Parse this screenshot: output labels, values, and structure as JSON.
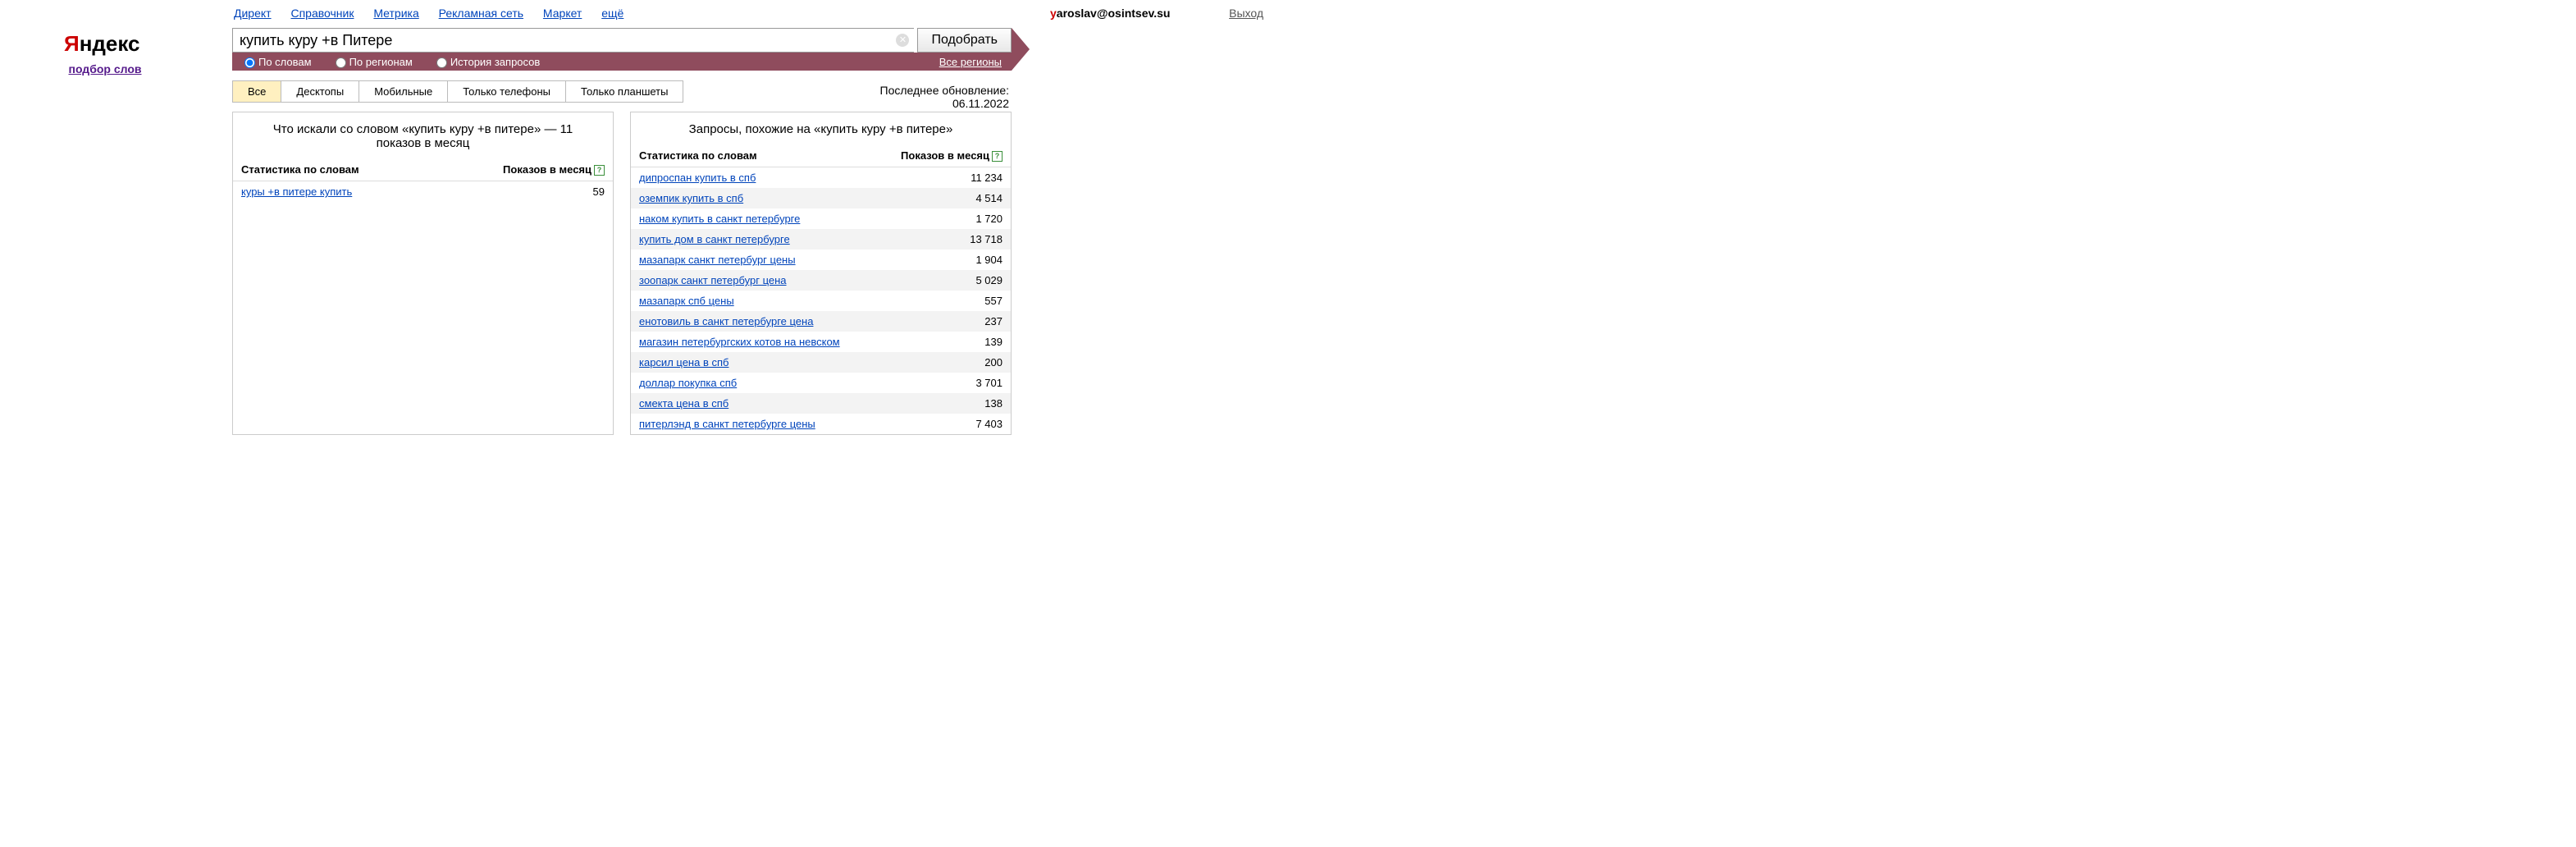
{
  "top_nav": {
    "links": [
      "Директ",
      "Справочник",
      "Метрика",
      "Рекламная сеть",
      "Маркет",
      "ещё"
    ]
  },
  "user": {
    "email_first": "y",
    "email_rest": "aroslav@osintsev.su",
    "logout": "Выход"
  },
  "logo": {
    "subtitle": "подбор слов"
  },
  "search": {
    "value": "купить куру +в Питере",
    "submit": "Подобрать",
    "mode_words": "По словам",
    "mode_regions": "По регионам",
    "mode_history": "История запросов",
    "regions_label": "Все регионы"
  },
  "device_tabs": [
    "Все",
    "Десктопы",
    "Мобильные",
    "Только телефоны",
    "Только планшеты"
  ],
  "last_update": "Последнее обновление: 06.11.2022",
  "left_panel": {
    "title": "Что искали со словом «купить куру +в питере» — 11 показов в месяц",
    "col_stat": "Статистика по словам",
    "col_shows": "Показов в месяц",
    "rows": [
      {
        "phrase": "куры +в питере купить",
        "shows": "59"
      }
    ]
  },
  "right_panel": {
    "title": "Запросы, похожие на «купить куру +в питере»",
    "col_stat": "Статистика по словам",
    "col_shows": "Показов в месяц",
    "rows": [
      {
        "phrase": "дипроспан купить в спб",
        "shows": "11 234"
      },
      {
        "phrase": "оземпик купить в спб",
        "shows": "4 514"
      },
      {
        "phrase": "наком купить в санкт петербурге",
        "shows": "1 720"
      },
      {
        "phrase": "купить дом в санкт петербурге",
        "shows": "13 718"
      },
      {
        "phrase": "мазапарк санкт петербург цены",
        "shows": "1 904"
      },
      {
        "phrase": "зоопарк санкт петербург цена",
        "shows": "5 029"
      },
      {
        "phrase": "мазапарк спб цены",
        "shows": "557"
      },
      {
        "phrase": "енотовиль в санкт петербурге цена",
        "shows": "237"
      },
      {
        "phrase": "магазин петербургских котов на невском",
        "shows": "139"
      },
      {
        "phrase": "карсил цена в спб",
        "shows": "200"
      },
      {
        "phrase": "доллар покупка спб",
        "shows": "3 701"
      },
      {
        "phrase": "смекта цена в спб",
        "shows": "138"
      },
      {
        "phrase": "питерлэнд в санкт петербурге цены",
        "shows": "7 403"
      }
    ]
  }
}
